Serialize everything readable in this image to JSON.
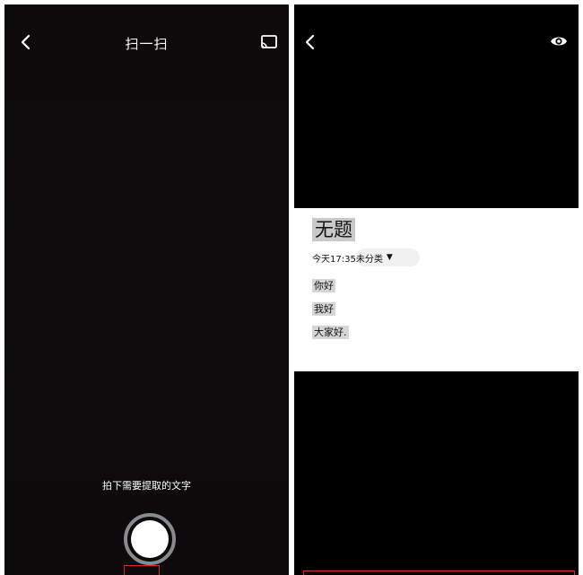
{
  "scan_screen": {
    "title": "扫一扫",
    "hint": "拍下需要提取的文字",
    "icons": {
      "back": "back-chevron-icon",
      "cast": "cast-screen-icon"
    }
  },
  "result_screen": {
    "icons": {
      "back": "back-chevron-icon",
      "preview": "eye-icon"
    },
    "note": {
      "title": "无题",
      "time": "今天17:35",
      "category": "未分类",
      "category_arrow": "▼",
      "lines": [
        "你好",
        "我好",
        "大家好."
      ]
    }
  },
  "colors": {
    "camera_bg": "#0d0a0b",
    "result_bg": "#000000",
    "highlight": "#c9c9c9",
    "annotation_red": "#d42b2b"
  }
}
